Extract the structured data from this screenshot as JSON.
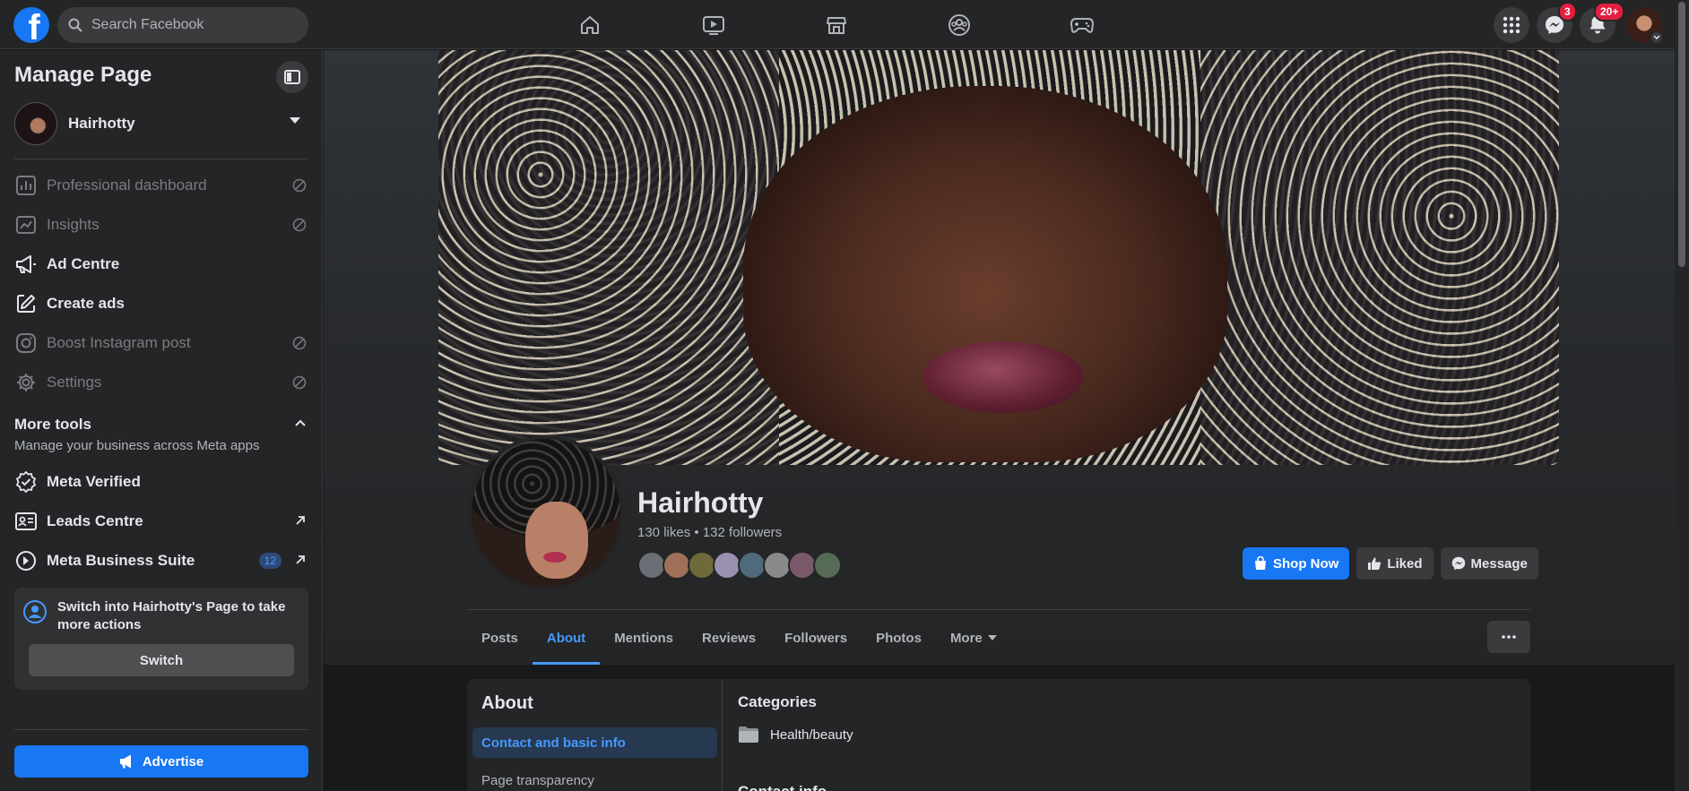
{
  "topbar": {
    "search_placeholder": "Search Facebook",
    "messenger_badge": "3",
    "notifications_badge": "20+",
    "nav_icons": [
      "home-icon",
      "video-icon",
      "marketplace-icon",
      "groups-icon",
      "gaming-icon"
    ]
  },
  "sidebar": {
    "title": "Manage Page",
    "page_name": "Hairhotty",
    "items": [
      {
        "label": "Professional dashboard",
        "icon": "dashboard-icon",
        "enabled": false
      },
      {
        "label": "Insights",
        "icon": "insights-icon",
        "enabled": false
      },
      {
        "label": "Ad Centre",
        "icon": "megaphone-icon",
        "enabled": true
      },
      {
        "label": "Create ads",
        "icon": "edit-icon",
        "enabled": true
      },
      {
        "label": "Boost Instagram post",
        "icon": "instagram-icon",
        "enabled": false
      },
      {
        "label": "Settings",
        "icon": "gear-icon",
        "enabled": false
      }
    ],
    "more_tools": {
      "title": "More tools",
      "subtitle": "Manage your business across Meta apps",
      "items": [
        {
          "label": "Meta Verified",
          "icon": "verified-icon"
        },
        {
          "label": "Leads Centre",
          "icon": "leads-icon"
        },
        {
          "label": "Meta Business Suite",
          "icon": "business-suite-icon",
          "badge": "12"
        }
      ]
    },
    "switch_card": {
      "text": "Switch into Hairhotty's Page to take more actions",
      "button": "Switch"
    },
    "advertise_button": "Advertise"
  },
  "profile": {
    "name": "Hairhotty",
    "stats": "130 likes • 132 followers",
    "buttons": {
      "shop": "Shop Now",
      "liked": "Liked",
      "message": "Message"
    }
  },
  "tabs": [
    "Posts",
    "About",
    "Mentions",
    "Reviews",
    "Followers",
    "Photos",
    "More"
  ],
  "active_tab": "About",
  "about": {
    "heading": "About",
    "nav": [
      "Contact and basic info",
      "Page transparency"
    ],
    "categories_heading": "Categories",
    "category": "Health/beauty",
    "contact_heading": "Contact info"
  },
  "colors": {
    "accent": "#1877f2",
    "link": "#4599ff",
    "badge": "#e41e3f",
    "surface": "#242526",
    "background": "#18191a"
  }
}
